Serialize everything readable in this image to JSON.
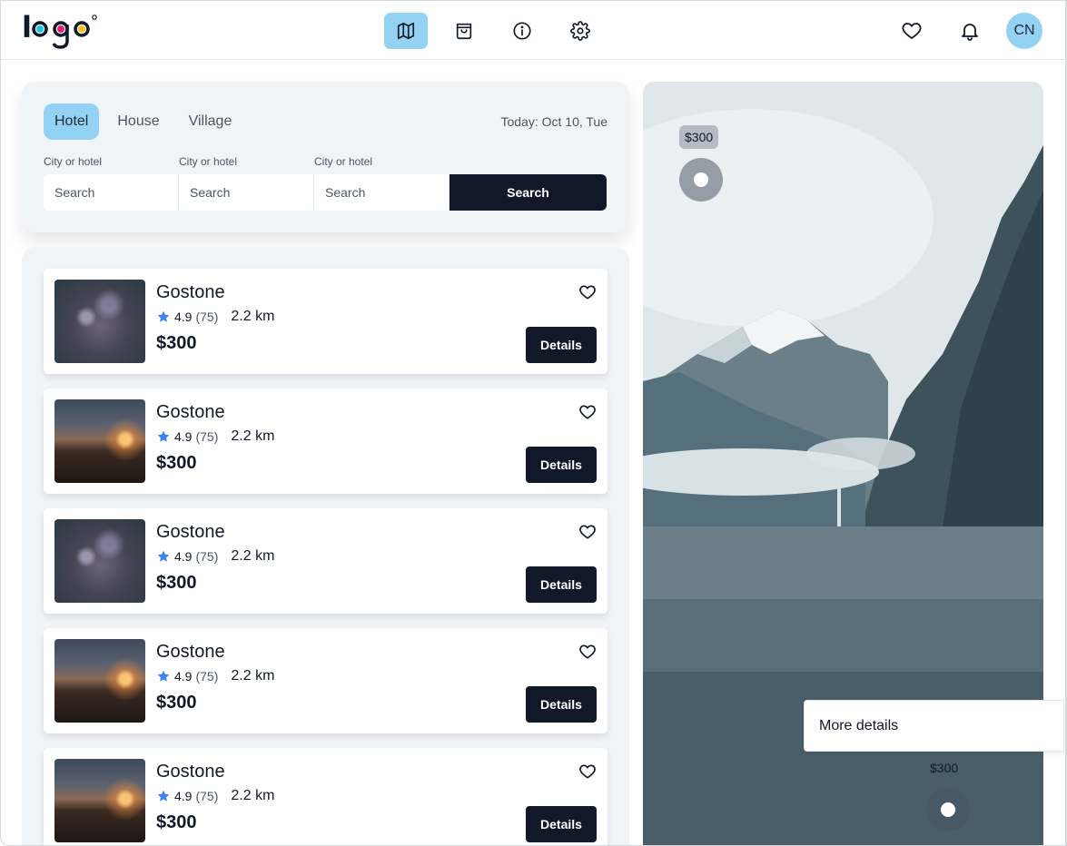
{
  "header": {
    "logo_text": "logo",
    "nav": [
      {
        "name": "map",
        "icon": "map-icon"
      },
      {
        "name": "shopping-bag",
        "icon": "shopping-bag-icon"
      },
      {
        "name": "info",
        "icon": "info-icon"
      },
      {
        "name": "settings",
        "icon": "gear-icon"
      }
    ],
    "active_nav": "map",
    "avatar_initials": "CN"
  },
  "search": {
    "tabs": [
      "Hotel",
      "House",
      "Village"
    ],
    "active_tab": "Hotel",
    "today": "Today: Oct 10, Tue",
    "fields": [
      {
        "label": "City or hotel",
        "placeholder": "Search"
      },
      {
        "label": "City or hotel",
        "placeholder": "Search"
      },
      {
        "label": "City or hotel",
        "placeholder": "Search"
      }
    ],
    "button_label": "Search"
  },
  "results": [
    {
      "title": "Gostone",
      "rating": "4.9",
      "reviews": "(75)",
      "distance": "2.2 km",
      "price": "$300",
      "button": "Details",
      "image": "night-sky"
    },
    {
      "title": "Gostone",
      "rating": "4.9",
      "reviews": "(75)",
      "distance": "2.2 km",
      "price": "$300",
      "button": "Details",
      "image": "campfire"
    },
    {
      "title": "Gostone",
      "rating": "4.9",
      "reviews": "(75)",
      "distance": "2.2 km",
      "price": "$300",
      "button": "Details",
      "image": "night-sky"
    },
    {
      "title": "Gostone",
      "rating": "4.9",
      "reviews": "(75)",
      "distance": "2.2 km",
      "price": "$300",
      "button": "Details",
      "image": "campfire"
    },
    {
      "title": "Gostone",
      "rating": "4.9",
      "reviews": "(75)",
      "distance": "2.2 km",
      "price": "$300",
      "button": "Details",
      "image": "campfire"
    }
  ],
  "map": {
    "markers": [
      {
        "price": "$300"
      },
      {
        "price": "$300"
      }
    ],
    "popup_link": "More details"
  },
  "colors": {
    "accent": "#93d2f2",
    "dark": "#111827",
    "panel": "#f1f4f7",
    "star": "#3b82f6"
  }
}
